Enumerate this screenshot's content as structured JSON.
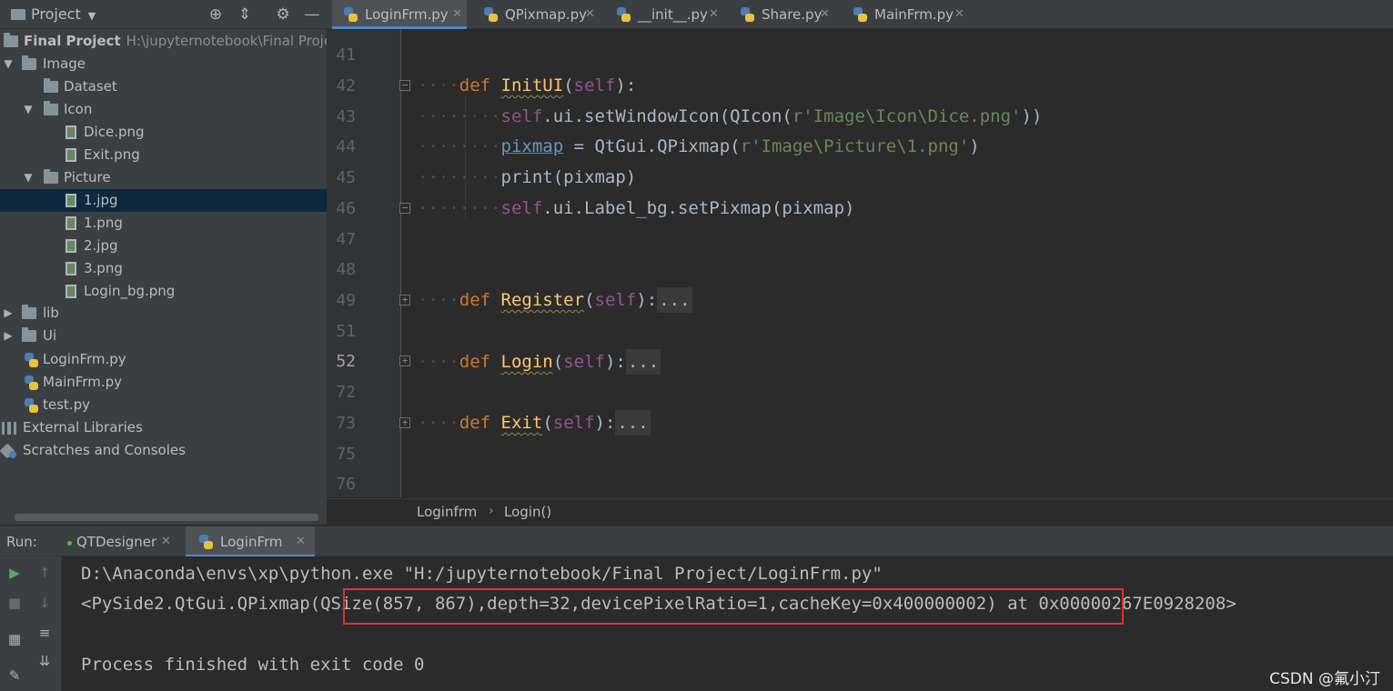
{
  "project_panel": {
    "title": "Project",
    "tree": [
      {
        "label": "Final Project",
        "path": "H:\\jupyternotebook\\Final Projec",
        "icon": "folder-icon",
        "expanded": true
      },
      {
        "label": "Image",
        "icon": "folder-icon",
        "expanded": true
      },
      {
        "label": "Dataset",
        "icon": "folder-icon"
      },
      {
        "label": "Icon",
        "icon": "folder-icon",
        "expanded": true
      },
      {
        "label": "Dice.png",
        "icon": "image-file-icon"
      },
      {
        "label": "Exit.png",
        "icon": "image-file-icon"
      },
      {
        "label": "Picture",
        "icon": "folder-icon",
        "expanded": true
      },
      {
        "label": "1.jpg",
        "icon": "image-file-icon",
        "selected": true
      },
      {
        "label": "1.png",
        "icon": "image-file-icon"
      },
      {
        "label": "2.jpg",
        "icon": "image-file-icon"
      },
      {
        "label": "3.png",
        "icon": "image-file-icon"
      },
      {
        "label": "Login_bg.png",
        "icon": "image-file-icon"
      },
      {
        "label": "lib",
        "icon": "folder-icon",
        "expanded": false
      },
      {
        "label": "Ui",
        "icon": "folder-icon",
        "expanded": false
      },
      {
        "label": "LoginFrm.py",
        "icon": "python-file-icon"
      },
      {
        "label": "MainFrm.py",
        "icon": "python-file-icon"
      },
      {
        "label": "test.py",
        "icon": "python-file-icon"
      },
      {
        "label": "External Libraries",
        "icon": "libraries-icon"
      },
      {
        "label": "Scratches and Consoles",
        "icon": "scratches-icon"
      }
    ]
  },
  "editor_tabs": [
    {
      "label": "LoginFrm.py",
      "active": true
    },
    {
      "label": "QPixmap.py"
    },
    {
      "label": "__init__.py"
    },
    {
      "label": "Share.py"
    },
    {
      "label": "MainFrm.py"
    }
  ],
  "editor": {
    "line_numbers": [
      "41",
      "42",
      "43",
      "44",
      "45",
      "46",
      "47",
      "48",
      "49",
      "51",
      "52",
      "72",
      "73",
      "75",
      "76"
    ],
    "current_line": "52",
    "code": {
      "l42_def": "def",
      "l42_name": "InitUI",
      "l42_self": "self",
      "l43_self": "self",
      "l43_call": ".ui.setWindowIcon(QIcon(",
      "l43_str": "r'Image\\Icon\\Dice.png'",
      "l43_end": "))",
      "l44_var": "pixmap",
      "l44_mid": " = QtGui.QPixmap(",
      "l44_str": "r'Image\\Picture\\1.png'",
      "l44_end": ")",
      "l45_code": "print(pixmap)",
      "l46_self": "self",
      "l46_code": ".ui.Label_bg.setPixmap(pixmap)",
      "l49_def": "def",
      "l49_name": "Register",
      "l49_self": "self",
      "l52_def": "def",
      "l52_name": "Login",
      "l52_self": "self",
      "l73_def": "def",
      "l73_name": "Exit",
      "l73_self": "self",
      "folded": "..."
    }
  },
  "breadcrumb": [
    "Loginfrm",
    "Login()"
  ],
  "run_panel": {
    "label": "Run:",
    "tabs": [
      {
        "label": "QTDesigner"
      },
      {
        "label": "LoginFrm",
        "active": true
      }
    ],
    "console": {
      "cmd": "D:\\Anaconda\\envs\\xp\\python.exe \"H:/jupyternotebook/Final Project/LoginFrm.py\"",
      "output_prefix": "<PySide2.QtGui.QPixmap",
      "output_highlighted": "(QSize(857, 867),depth=32,devicePixelRatio=1,cacheKey=0x400000002)",
      "output_suffix": " at 0x00000267E0928208>",
      "exit_msg": "Process finished with exit code 0"
    }
  },
  "watermark": "CSDN @氟小汀",
  "colors": {
    "highlight_box": "#e03030",
    "selection": "#0d293e",
    "keyword": "#cc7832",
    "function": "#ffc66d",
    "string": "#6a8759",
    "self": "#94558d"
  }
}
